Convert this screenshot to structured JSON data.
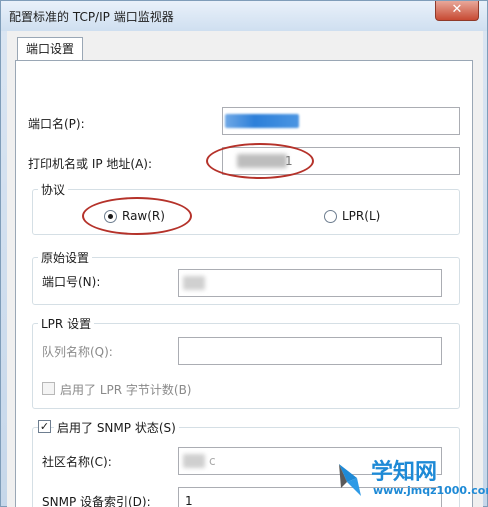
{
  "window": {
    "title": "配置标准的 TCP/IP 端口监视器",
    "close_glyph": "✕"
  },
  "tab": {
    "label": "端口设置"
  },
  "port_name": {
    "label": "端口名(P):"
  },
  "printer_address": {
    "label": "打印机名或 IP 地址(A):",
    "visible_tail": "1"
  },
  "protocol": {
    "title": "协议",
    "raw_label": "Raw(R)",
    "lpr_label": "LPR(L)",
    "selected": "Raw"
  },
  "raw_settings": {
    "title": "原始设置",
    "port_number_label": "端口号(N):"
  },
  "lpr_settings": {
    "title": "LPR 设置",
    "queue_name_label": "队列名称(Q):",
    "byte_count_label": "启用了 LPR 字节计数(B)"
  },
  "snmp": {
    "enabled_label": "启用了 SNMP 状态(S)",
    "community_label": "社区名称(C):",
    "community_visible": "c",
    "device_index_label": "SNMP 设备索引(D):",
    "device_index_value": "1"
  },
  "watermark": {
    "title": "学知网",
    "url": "www.jmqz1000.com"
  },
  "colors": {
    "annotation": "#b5322a",
    "watermark": "#1e8ad6"
  }
}
